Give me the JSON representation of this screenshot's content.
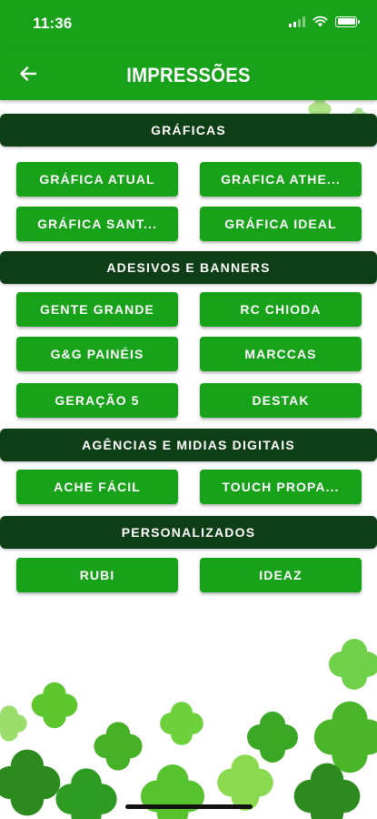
{
  "status_bar": {
    "time": "11:36"
  },
  "app_bar": {
    "title": "IMPRESSÕES"
  },
  "sections": [
    {
      "title": "GRÁFICAS",
      "items": [
        "GRÁFICA ATUAL",
        "GRAFICA ATHE...",
        "GRÁFICA SANT...",
        "GRÁFICA IDEAL"
      ]
    },
    {
      "title": "ADESIVOS E BANNERS",
      "items": [
        "GENTE GRANDE",
        "RC CHIODA",
        "G&G PAINÉIS",
        "MARCCAS",
        "GERAÇÃO 5",
        "DESTAK"
      ]
    },
    {
      "title": "AGÊNCIAS E MIDIAS DIGITAIS",
      "items": [
        "ACHE FÁCIL",
        "TOUCH PROPA..."
      ]
    },
    {
      "title": "PERSONALIZADOS",
      "items": [
        "RUBI",
        "IDEAZ"
      ]
    }
  ],
  "colors": {
    "primary": "#18a21a",
    "section_header": "#0e3e16",
    "clover_light": "#5cc62c",
    "clover_dark": "#2d8a1f"
  },
  "icons": {
    "back": "arrow-left-icon",
    "decoration": "clover-icon"
  }
}
